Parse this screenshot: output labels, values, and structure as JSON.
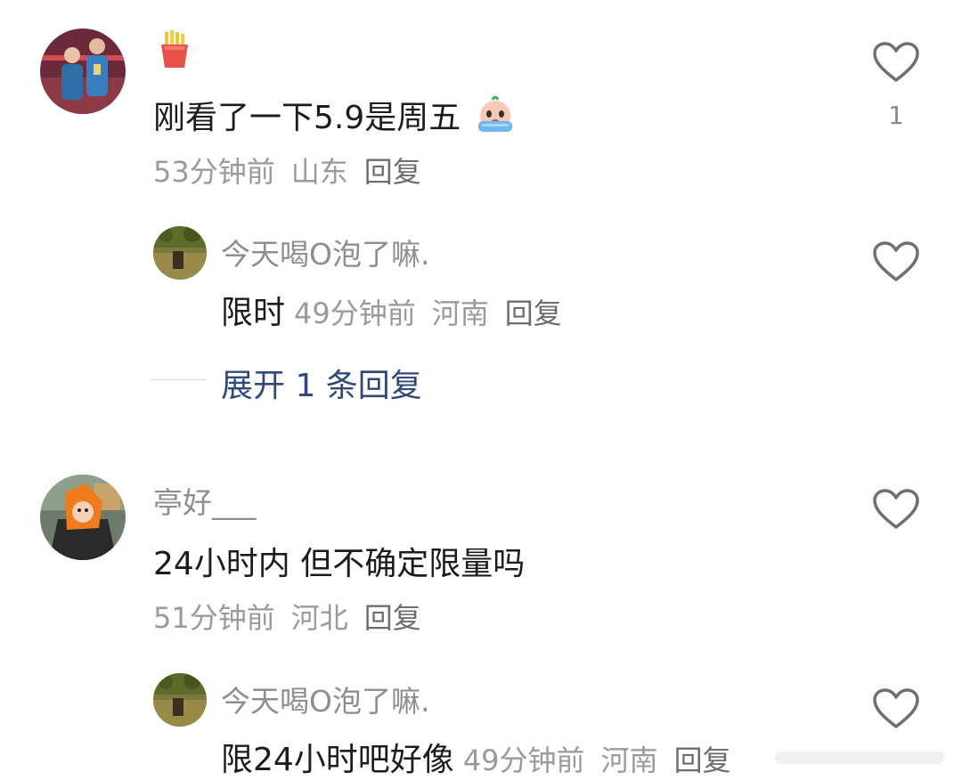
{
  "comments": [
    {
      "username_emoji": "fries-emoji",
      "text": "刚看了一下5.9是周五",
      "text_emoji": "crying-face-emoji",
      "time": "53分钟前",
      "location": "山东",
      "reply_label": "回复",
      "likes": "1",
      "replies": [
        {
          "username": "今天喝O泡了嘛.",
          "text": "限时",
          "time": "49分钟前",
          "location": "河南",
          "reply_label": "回复"
        }
      ],
      "expand_label": "展开 1 条回复"
    },
    {
      "username": "亭好___",
      "text": "24小时内 但不确定限量吗",
      "time": "51分钟前",
      "location": "河北",
      "reply_label": "回复",
      "replies": [
        {
          "username": "今天喝O泡了嘛.",
          "text": "限24小时吧好像",
          "time": "49分钟前",
          "location": "河南",
          "reply_label": "回复"
        }
      ]
    }
  ],
  "colors": {
    "link_blue": "#2f4a78",
    "meta_gray": "#9a9a9a",
    "text_dark": "#1c1c1c"
  }
}
